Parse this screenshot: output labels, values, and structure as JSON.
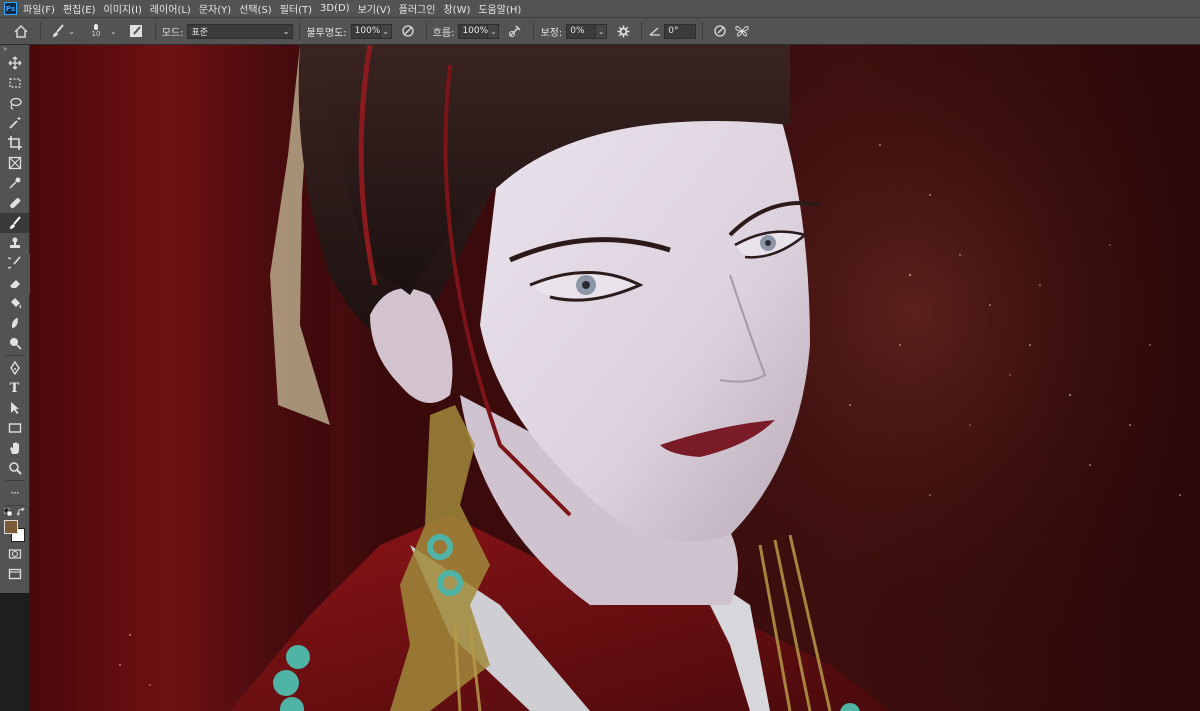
{
  "app": {
    "logo": "Ps"
  },
  "menu": [
    {
      "label": "파일(F)"
    },
    {
      "label": "편집(E)"
    },
    {
      "label": "이미지(I)"
    },
    {
      "label": "레이어(L)"
    },
    {
      "label": "문자(Y)"
    },
    {
      "label": "선택(S)"
    },
    {
      "label": "필터(T)"
    },
    {
      "label": "3D(D)"
    },
    {
      "label": "보기(V)"
    },
    {
      "label": "플러그인"
    },
    {
      "label": "창(W)"
    },
    {
      "label": "도움말(H)"
    }
  ],
  "options": {
    "brush_size": "10",
    "mode_label": "모드:",
    "mode_value": "표준",
    "opacity_label": "불투명도:",
    "opacity_value": "100%",
    "flow_label": "흐름:",
    "flow_value": "100%",
    "smoothing_label": "보정:",
    "smoothing_value": "0%",
    "angle_value": "0°"
  },
  "toolbar": {
    "collapse": "»",
    "tools": [
      {
        "name": "move-tool",
        "icon": "move-icon"
      },
      {
        "name": "marquee-tool",
        "icon": "marquee-icon"
      },
      {
        "name": "lasso-tool",
        "icon": "lasso-icon"
      },
      {
        "name": "magic-wand-tool",
        "icon": "magic-wand-icon"
      },
      {
        "name": "crop-tool",
        "icon": "crop-icon"
      },
      {
        "name": "frame-tool",
        "icon": "frame-icon"
      },
      {
        "name": "eyedropper-tool",
        "icon": "eyedropper-icon"
      },
      {
        "name": "healing-brush-tool",
        "icon": "bandage-icon"
      },
      {
        "name": "brush-tool",
        "icon": "brush-icon",
        "active": true
      },
      {
        "name": "clone-stamp-tool",
        "icon": "stamp-icon"
      },
      {
        "name": "history-brush-tool",
        "icon": "history-brush-icon"
      },
      {
        "name": "eraser-tool",
        "icon": "eraser-icon"
      },
      {
        "name": "paint-bucket-tool",
        "icon": "bucket-icon"
      },
      {
        "name": "blur-tool",
        "icon": "drop-icon"
      },
      {
        "name": "dodge-tool",
        "icon": "dodge-icon"
      },
      {
        "name": "pen-tool",
        "icon": "pen-icon"
      },
      {
        "name": "type-tool",
        "icon": "type-icon"
      },
      {
        "name": "path-selection-tool",
        "icon": "arrow-icon"
      },
      {
        "name": "rectangle-tool",
        "icon": "rectangle-icon"
      },
      {
        "name": "hand-tool",
        "icon": "hand-icon"
      },
      {
        "name": "zoom-tool",
        "icon": "zoom-icon"
      }
    ],
    "type_glyph": "T",
    "more": "···"
  },
  "colors": {
    "foreground": "#7a5a35",
    "background": "#ffffff",
    "ui_bg": "#535353",
    "ui_dark": "#3b3b3b"
  },
  "mini_panel": {
    "collapse": "»",
    "close": "×"
  }
}
